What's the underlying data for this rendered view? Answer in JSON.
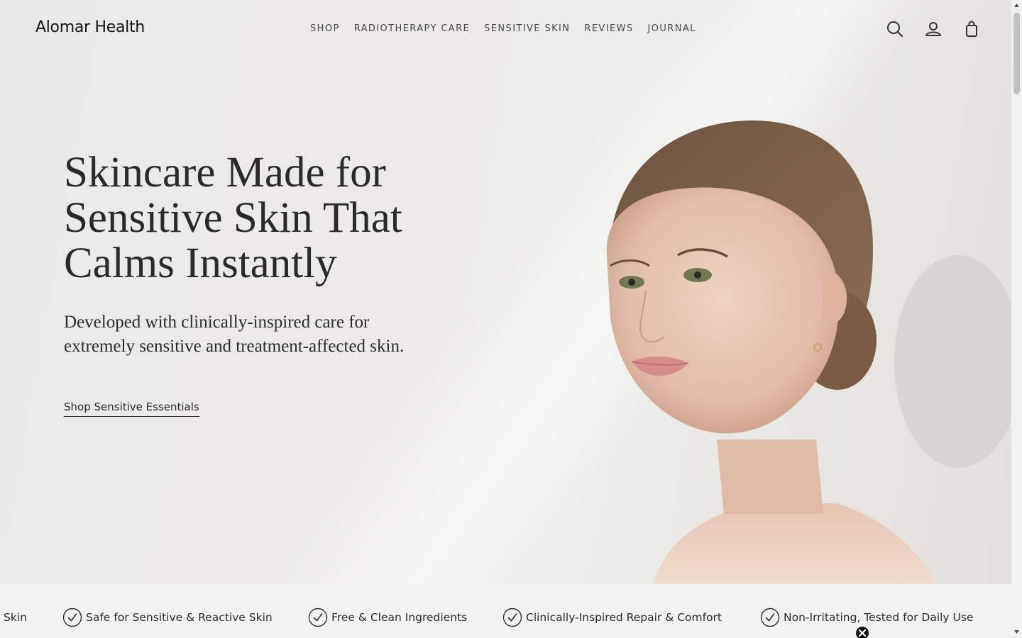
{
  "brand": {
    "name": "Alomar Health"
  },
  "nav": {
    "items": [
      "SHOP",
      "RADIOTHERAPY CARE",
      "SENSITIVE SKIN",
      "REVIEWS",
      "JOURNAL"
    ]
  },
  "header_icons": [
    "search-icon",
    "account-icon",
    "cart-icon"
  ],
  "hero": {
    "title_line1": "Skincare Made for",
    "title_line2": "Sensitive Skin That",
    "title_line3": "Calms Instantly",
    "subtitle_line1": "Developed with clinically-inspired care for",
    "subtitle_line2": "extremely sensitive and treatment-affected skin.",
    "cta": "Shop Sensitive Essentials"
  },
  "benefits": {
    "edge_text": "Skin",
    "items": [
      "Safe for Sensitive & Reactive Skin",
      "Free & Clean Ingredients",
      "Clinically-Inspired Repair & Comfort",
      "Non-Irritating, Tested for Daily Use"
    ]
  },
  "colors": {
    "text": "#2b2b2b",
    "benefit_bar": "#f2f2f3",
    "hero_bg": "#ebeae7"
  }
}
